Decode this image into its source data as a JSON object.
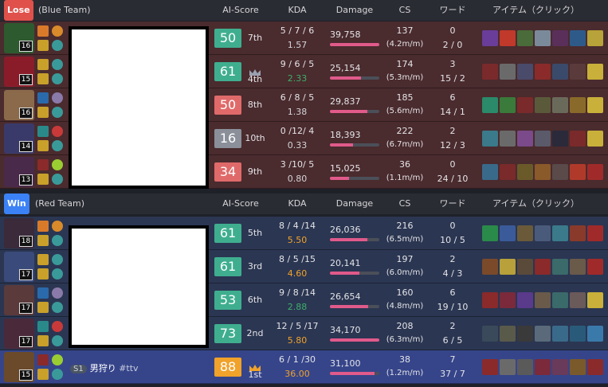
{
  "columns": {
    "ai_score": "AI-Score",
    "kda": "KDA",
    "damage": "Damage",
    "cs": "CS",
    "ward": "ワード",
    "items": "アイテム（クリック）"
  },
  "colors": {
    "lose": "#e0514b",
    "win": "#3b82f6",
    "score_high": "#3fae8f",
    "score_low": "#e06a6a",
    "score_mid": "#8a8f99",
    "score_top": "#f0a22a",
    "ratio_green": "#3fae6a",
    "ratio_orange": "#f0a22a"
  },
  "blue_team": {
    "result": "Lose",
    "name": "(Blue Team)",
    "players": [
      {
        "level": "16",
        "score": "50",
        "score_color": "score_high",
        "rank": "7th",
        "crown": false,
        "kda": "5 / 7 / 6",
        "ratio": "1.57",
        "ratio_color": "",
        "damage": "39,758",
        "damage_pct": 1.0,
        "cs": "137",
        "cs_min": "(4.2m/m)",
        "ward": "0",
        "ward_sub": "2 / 0",
        "name": "",
        "champ_color": "#2d5a2f",
        "items": [
          "#6a3d9a",
          "#c0392b",
          "#4a6b3a",
          "#7a8a9a",
          "#5a2f5a",
          "#2e5a8a",
          "#b8a23a"
        ]
      },
      {
        "level": "15",
        "score": "61",
        "score_color": "score_high",
        "rank": "4th",
        "crown": true,
        "kda": "9 / 6 / 5",
        "ratio": "2.33",
        "ratio_color": "ratio_green",
        "damage": "25,154",
        "damage_pct": 0.63,
        "cs": "174",
        "cs_min": "(5.3m/m)",
        "ward": "3",
        "ward_sub": "15 / 2",
        "name": "",
        "champ_color": "#8a1c2a",
        "items": [
          "#7a2a2a",
          "#6a6a6a",
          "#4a4a6a",
          "#8a2a2a",
          "#3a4a6a",
          "#5a3a3a",
          "#c8b03a"
        ]
      },
      {
        "level": "16",
        "score": "50",
        "score_color": "score_low",
        "rank": "8th",
        "crown": false,
        "kda": "6 / 8 / 5",
        "ratio": "1.38",
        "ratio_color": "",
        "damage": "29,837",
        "damage_pct": 0.75,
        "cs": "185",
        "cs_min": "(5.6m/m)",
        "ward": "6",
        "ward_sub": "14 / 1",
        "name": "",
        "champ_color": "#8a6a4a",
        "items": [
          "#2a8a6a",
          "#3a7a3a",
          "#7a2a2a",
          "#5a5a3a",
          "#6a6a5a",
          "#8a6a2a",
          "#c8b03a"
        ]
      },
      {
        "level": "14",
        "score": "16",
        "score_color": "score_mid",
        "rank": "10th",
        "crown": false,
        "kda": "0 /12/ 4",
        "ratio": "0.33",
        "ratio_color": "",
        "damage": "18,393",
        "damage_pct": 0.46,
        "cs": "222",
        "cs_min": "(6.7m/m)",
        "ward": "2",
        "ward_sub": "12 / 3",
        "name": "",
        "champ_color": "#3a3a6a",
        "items": [
          "#3a7a8a",
          "#6a6a6a",
          "#7a4a8a",
          "#5a5a6a",
          "#2a2a3a",
          "#7a2a2a",
          "#c8b03a"
        ]
      },
      {
        "level": "13",
        "score": "34",
        "score_color": "score_low",
        "rank": "9th",
        "crown": false,
        "kda": "3 /10/ 5",
        "ratio": "0.80",
        "ratio_color": "",
        "damage": "15,025",
        "damage_pct": 0.38,
        "cs": "36",
        "cs_min": "(1.1m/m)",
        "ward": "0",
        "ward_sub": "24 / 10",
        "name": "",
        "champ_color": "#4a2a4a",
        "items": [
          "#3a6a8a",
          "#7a2a2a",
          "#6a5a2a",
          "#8a5a2a",
          "#5a4a4a",
          "#b03a2a",
          "#a02a2a"
        ]
      }
    ]
  },
  "red_team": {
    "result": "Win",
    "name": "(Red Team)",
    "players": [
      {
        "level": "18",
        "score": "61",
        "score_color": "score_high",
        "rank": "5th",
        "crown": false,
        "kda": "8 / 4 /14",
        "ratio": "5.50",
        "ratio_color": "ratio_orange",
        "damage": "26,036",
        "damage_pct": 0.76,
        "cs": "216",
        "cs_min": "(6.5m/m)",
        "ward": "0",
        "ward_sub": "10 / 5",
        "name": "",
        "champ_color": "#3a2a3a",
        "items": [
          "#2a8a4a",
          "#3a5a9a",
          "#6a5a3a",
          "#4a5a7a",
          "#3a7a8a",
          "#8a3a2a",
          "#a02a2a"
        ]
      },
      {
        "level": "17",
        "score": "61",
        "score_color": "score_high",
        "rank": "3rd",
        "crown": false,
        "kda": "8 / 5 /15",
        "ratio": "4.60",
        "ratio_color": "ratio_orange",
        "damage": "20,141",
        "damage_pct": 0.59,
        "cs": "197",
        "cs_min": "(6.0m/m)",
        "ward": "2",
        "ward_sub": "4 / 3",
        "name": "",
        "champ_color": "#3a4a7a",
        "items": [
          "#7a4a2a",
          "#b8a03a",
          "#5a4a3a",
          "#8a2a2a",
          "#3a6a6a",
          "#6a5a4a",
          "#a02a2a"
        ]
      },
      {
        "level": "17",
        "score": "53",
        "score_color": "score_high",
        "rank": "6th",
        "crown": false,
        "kda": "9 / 8 /14",
        "ratio": "2.88",
        "ratio_color": "ratio_green",
        "damage": "26,654",
        "damage_pct": 0.78,
        "cs": "160",
        "cs_min": "(4.8m/m)",
        "ward": "6",
        "ward_sub": "19 / 10",
        "name": "",
        "champ_color": "#5a3a3a",
        "items": [
          "#8a2a2a",
          "#7a2a3a",
          "#5a3a8a",
          "#6a5a4a",
          "#3a6a6a",
          "#6a5a5a",
          "#c8b03a"
        ]
      },
      {
        "level": "17",
        "score": "73",
        "score_color": "score_high",
        "rank": "2nd",
        "crown": false,
        "kda": "12 / 5 /17",
        "ratio": "5.80",
        "ratio_color": "ratio_orange",
        "damage": "34,170",
        "damage_pct": 1.0,
        "cs": "208",
        "cs_min": "(6.3m/m)",
        "ward": "2",
        "ward_sub": "6 / 5",
        "name": "",
        "champ_color": "#4a2a3a",
        "items": [
          "#3a4a5a",
          "#5a5a4a",
          "#3a3a3a",
          "#5a6a7a",
          "#3a6a8a",
          "#2a5a7a",
          "#3a7aaa"
        ]
      },
      {
        "level": "15",
        "score": "88",
        "score_color": "score_top",
        "rank": "1st",
        "crown": true,
        "kda": "6 / 1 /30",
        "ratio": "36.00",
        "ratio_color": "ratio_orange",
        "damage": "31,100",
        "damage_pct": 0.91,
        "cs": "38",
        "cs_min": "(1.2m/m)",
        "ward": "7",
        "ward_sub": "37 / 7",
        "name": "男狩り",
        "server": "S1",
        "tag": "#ttv",
        "champ_color": "#6a4a2a",
        "items": [
          "#8a2a2a",
          "#6a6a6a",
          "#5a5a5a",
          "#7a2a3a",
          "#6a3a5a",
          "#7a5a2a",
          "#8a2a2a"
        ]
      }
    ]
  }
}
